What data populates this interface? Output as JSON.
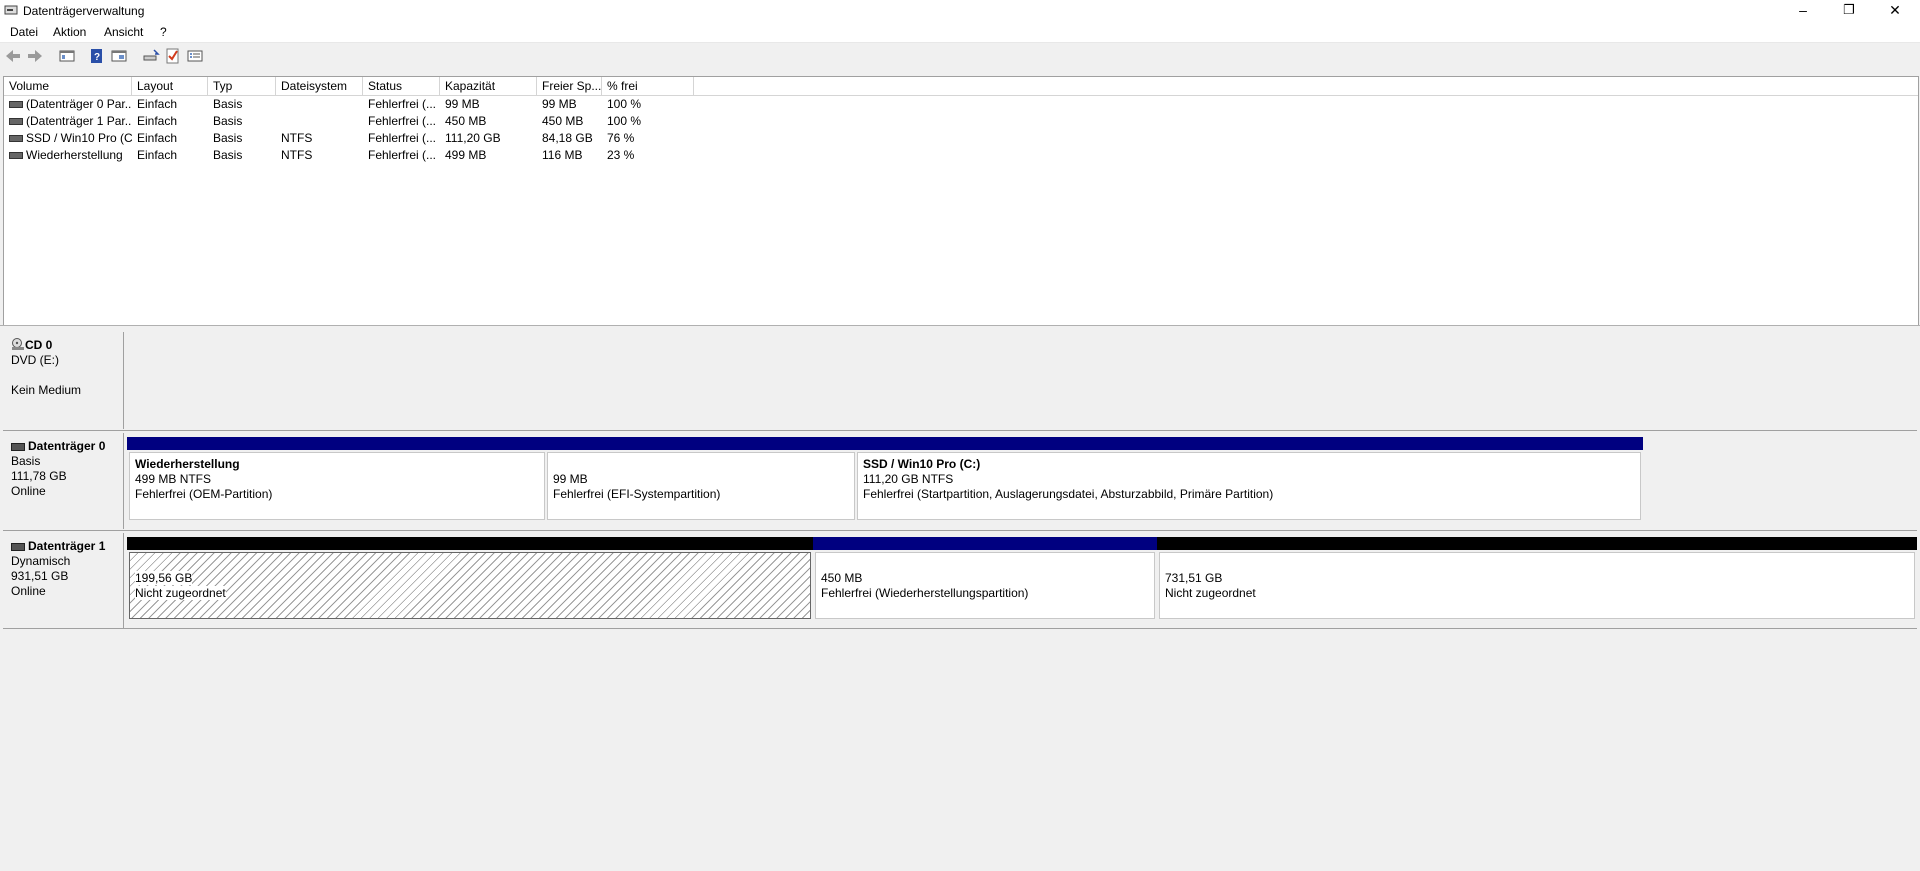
{
  "window": {
    "title": "Datenträgerverwaltung",
    "minimize": "–",
    "restore": "❐",
    "close": "✕"
  },
  "menu": [
    "Datei",
    "Aktion",
    "Ansicht",
    "?"
  ],
  "toolbar_icons": [
    "back-icon",
    "forward-icon",
    "console-tree-icon",
    "help-icon",
    "properties-icon",
    "rescan-icon",
    "checklist-icon",
    "list-view-icon"
  ],
  "volume_list": {
    "columns": [
      "Volume",
      "Layout",
      "Typ",
      "Dateisystem",
      "Status",
      "Kapazität",
      "Freier Sp...",
      "% frei"
    ],
    "rows": [
      [
        "(Datenträger 0 Par...",
        "Einfach",
        "Basis",
        "",
        "Fehlerfrei (...",
        "99 MB",
        "99 MB",
        "100 %"
      ],
      [
        "(Datenträger 1 Par...",
        "Einfach",
        "Basis",
        "",
        "Fehlerfrei (...",
        "450 MB",
        "450 MB",
        "100 %"
      ],
      [
        "SSD / Win10 Pro (C:)",
        "Einfach",
        "Basis",
        "NTFS",
        "Fehlerfrei (...",
        "111,20 GB",
        "84,18 GB",
        "76 %"
      ],
      [
        "Wiederherstellung",
        "Einfach",
        "Basis",
        "NTFS",
        "Fehlerfrei (...",
        "499 MB",
        "116 MB",
        "23 %"
      ]
    ]
  },
  "disks": {
    "cd0": {
      "name": "CD 0",
      "type": "DVD (E:)",
      "status": "Kein Medium"
    },
    "disk0": {
      "name": "Datenträger 0",
      "type": "Basis",
      "size": "111,78 GB",
      "status": "Online",
      "partitions": [
        {
          "title": "Wiederherstellung",
          "size": "499 MB NTFS",
          "status": "Fehlerfrei (OEM-Partition)"
        },
        {
          "title": "",
          "size": "99 MB",
          "status": "Fehlerfrei (EFI-Systempartition)"
        },
        {
          "title": "SSD / Win10 Pro  (C:)",
          "size": "111,20 GB NTFS",
          "status": "Fehlerfrei (Startpartition, Auslagerungsdatei, Absturzabbild, Primäre Partition)"
        }
      ]
    },
    "disk1": {
      "name": "Datenträger 1",
      "type": "Dynamisch",
      "size": "931,51 GB",
      "status": "Online",
      "partitions": [
        {
          "size": "199,56 GB",
          "status": "Nicht zugeordnet"
        },
        {
          "size": "450 MB",
          "status": "Fehlerfrei (Wiederherstellungspartition)"
        },
        {
          "size": "731,51 GB",
          "status": "Nicht zugeordnet"
        }
      ]
    }
  },
  "colors": {
    "primary_bar": "#000080",
    "unallocated_bar": "#000000"
  }
}
